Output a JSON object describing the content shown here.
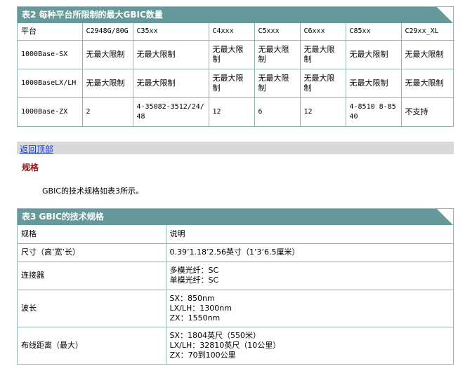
{
  "table2": {
    "title": "表2 每种平台所限制的最大GBIC数量",
    "headers": [
      "平台",
      "C2948G/80G",
      "C35xx",
      "C4xxx",
      "C5xxx",
      "C6xxx",
      "C85xx",
      "C29xx_XL"
    ],
    "rows": [
      [
        "1000Base-SX",
        "无最大限制",
        "无最大限制",
        "无最大限制",
        "无最大限制",
        "无最大限制",
        "无最大限制",
        "无最大限制"
      ],
      [
        "1000BaseLX/LH",
        "无最大限制",
        "无最大限制",
        "无最大限制",
        "无最大限制",
        "无最大限制",
        "无最大限制",
        "无最大限制"
      ],
      [
        "1000Base-ZX",
        "2",
        "4-35082-3512/24/48",
        "12",
        "6",
        "12",
        "4-8510 8-8540",
        "不支持"
      ]
    ]
  },
  "back_link": "返回顶部",
  "section_title": "规格",
  "paragraph": "GBIC的技术规格如表3所示。",
  "table3": {
    "title": "表3 GBIC的技术规格",
    "headers": [
      "规格",
      "说明"
    ],
    "rows": [
      {
        "spec": "尺寸（高’宽’长）",
        "lines": [
          "0.39’1.18’2.56英寸（1’3’6.5厘米）"
        ]
      },
      {
        "spec": "连接器",
        "lines": [
          "多模光纤：SC",
          "单模光纤：SC"
        ]
      },
      {
        "spec": "波长",
        "lines": [
          "SX：850nm",
          "LX/LH：1300nm",
          "ZX：1550nm"
        ]
      },
      {
        "spec": "布线距离（最大）",
        "lines": [
          "SX：1804英尺（550米）",
          "LX/LH：32810英尺（10公里）",
          "ZX：70到100公里"
        ]
      }
    ]
  },
  "colors": {
    "header_bg": "#66999a",
    "border": "#8fb5b5",
    "link": "#1a3ecc",
    "section_title": "#a01010",
    "backbar_bg": "#d9d9d9"
  }
}
